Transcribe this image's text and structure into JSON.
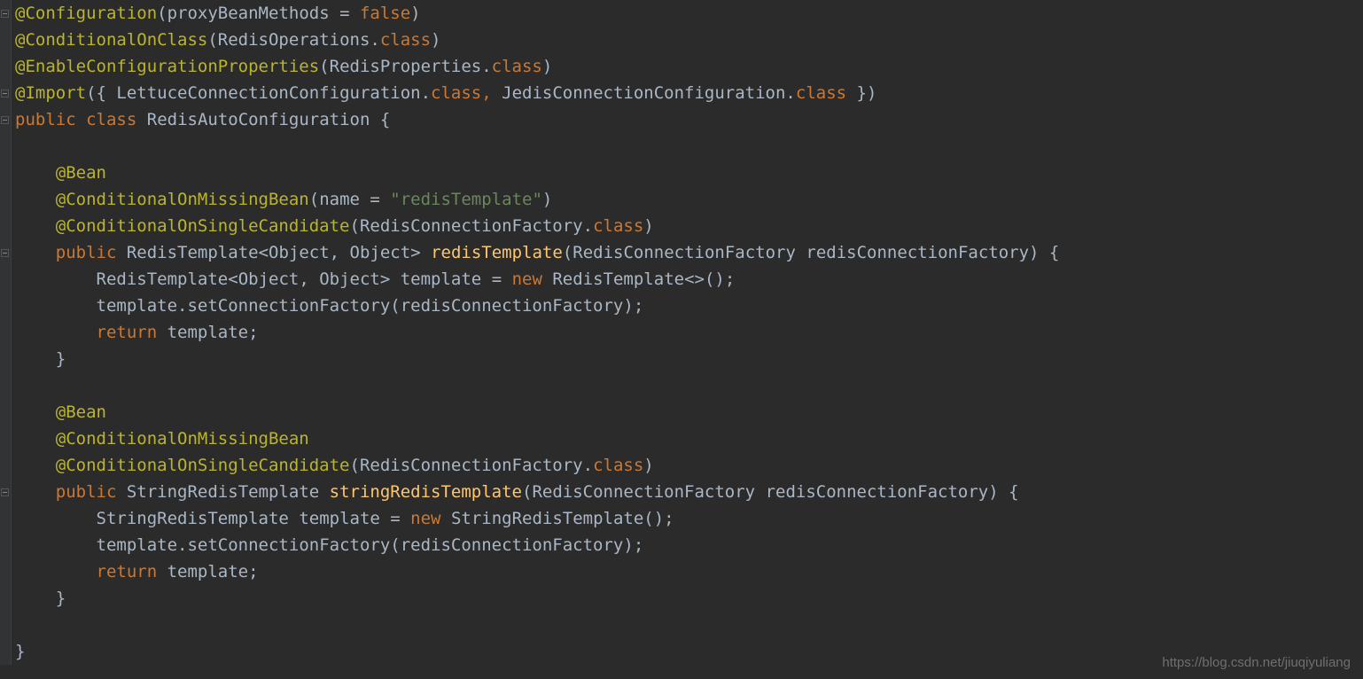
{
  "colors": {
    "annotation": "#bbb529",
    "keyword": "#cc7832",
    "string": "#6a8759",
    "method": "#ffc66d",
    "text": "#a9b7c6",
    "background": "#2b2b2b",
    "gutter": "#313335"
  },
  "watermark": "https://blog.csdn.net/jiuqiyuliang",
  "annotations": {
    "Configuration": "@Configuration",
    "ConditionalOnClass": "@ConditionalOnClass",
    "EnableConfigurationProperties": "@EnableConfigurationProperties",
    "Import": "@Import",
    "Bean": "@Bean",
    "ConditionalOnMissingBean": "@ConditionalOnMissingBean",
    "ConditionalOnSingleCandidate": "@ConditionalOnSingleCandidate"
  },
  "keywords": {
    "public": "public",
    "class": "class",
    "false": "false",
    "new": "new",
    "return": "return",
    "classRef": "class"
  },
  "strings": {
    "redisTemplate": "\"redisTemplate\""
  },
  "identifiers": {
    "proxyBeanMethods": "proxyBeanMethods",
    "RedisOperations": "RedisOperations",
    "RedisProperties": "RedisProperties",
    "LettuceConnectionConfiguration": "LettuceConnectionConfiguration",
    "JedisConnectionConfiguration": "JedisConnectionConfiguration",
    "RedisAutoConfiguration": "RedisAutoConfiguration",
    "name": "name",
    "RedisConnectionFactory": "RedisConnectionFactory",
    "RedisTemplate": "RedisTemplate",
    "ObjectObject": "Object, Object",
    "redisTemplateMethod": "redisTemplate",
    "redisConnectionFactory": "redisConnectionFactory",
    "template": "template",
    "setConnectionFactory": "setConnectionFactory",
    "StringRedisTemplate": "StringRedisTemplate",
    "stringRedisTemplate": "stringRedisTemplate"
  }
}
